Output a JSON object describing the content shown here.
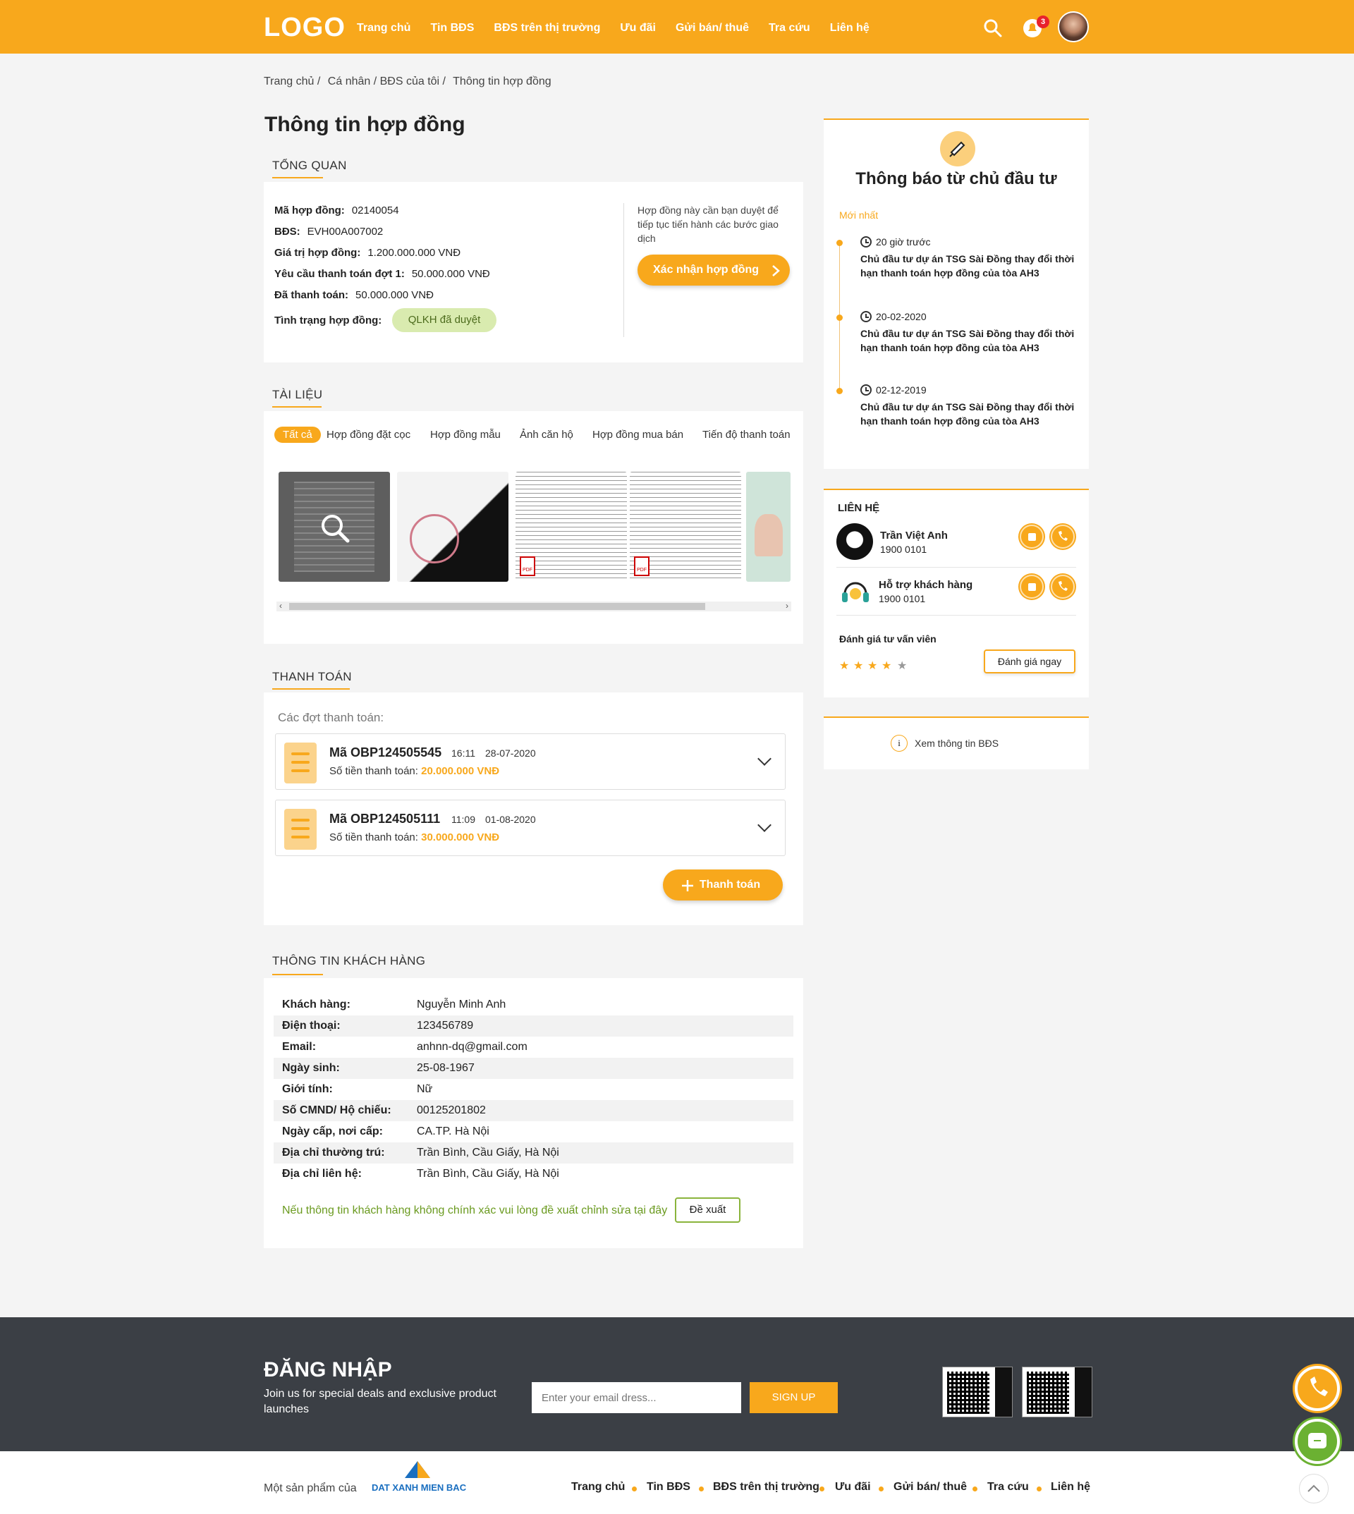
{
  "header": {
    "logo": "LOGO",
    "nav": [
      "Trang chủ",
      "Tin BĐS",
      "BĐS trên thị trường",
      "Ưu đãi",
      "Gửi bán/ thuê",
      "Tra cứu",
      "Liên hệ"
    ],
    "notif_count": "3"
  },
  "breadcrumb": [
    "Trang chủ /",
    "Cá nhân / BĐS của tôi /",
    "Thông tin hợp đồng"
  ],
  "page_title": "Thông tin hợp đồng",
  "overview": {
    "title": "TỔNG QUAN",
    "rows": [
      {
        "k": "Mã hợp đồng:",
        "v": "02140054"
      },
      {
        "k": "BĐS:",
        "v": "EVH00A007002"
      },
      {
        "k": "Giá trị hợp đồng:",
        "v": "1.200.000.000 VNĐ"
      },
      {
        "k": "Yêu cầu thanh toán đợt 1:",
        "v": "50.000.000 VNĐ"
      },
      {
        "k": "Đã thanh toán:",
        "v": "50.000.000 VNĐ"
      }
    ],
    "status_label": "Tình trạng hợp đồng:",
    "status": "QLKH đã duyệt",
    "note": "Hợp đồng này cần bạn duyệt để tiếp tục tiến hành các bước giao dịch",
    "confirm": "Xác nhận hợp đồng"
  },
  "docs": {
    "title": "TÀI LIỆU",
    "tabs": [
      "Tất cả",
      "Hợp đồng đặt cọc",
      "Hợp đồng mẫu",
      "Ảnh căn hộ",
      "Hợp đồng mua bán",
      "Tiến độ thanh toán"
    ]
  },
  "payment": {
    "title": "THANH TOÁN",
    "subtitle": "Các đợt thanh toán:",
    "items": [
      {
        "code": "Mã OBP124505545",
        "time": "16:11",
        "date": "28-07-2020",
        "amt_label": "Số tiền thanh toán:",
        "amt": "20.000.000 VNĐ"
      },
      {
        "code": "Mã OBP124505111",
        "time": "11:09",
        "date": "01-08-2020",
        "amt_label": "Số tiền thanh toán:",
        "amt": "30.000.000 VNĐ"
      }
    ],
    "button": "Thanh toán"
  },
  "customer": {
    "title": "THÔNG TIN KHÁCH HÀNG",
    "rows": [
      {
        "k": "Khách hàng:",
        "v": "Nguyễn Minh Anh"
      },
      {
        "k": "Điện thoại:",
        "v": "123456789"
      },
      {
        "k": "Email:",
        "v": "anhnn-dq@gmail.com"
      },
      {
        "k": "Ngày sinh:",
        "v": "25-08-1967"
      },
      {
        "k": "Giới tính:",
        "v": "Nữ"
      },
      {
        "k": "Số CMND/ Hộ chiếu:",
        "v": "00125201802"
      },
      {
        "k": "Ngày cấp, nơi cấp:",
        "v": "CA.TP. Hà Nội"
      },
      {
        "k": "Địa chỉ thường trú:",
        "v": "Trần Bình, Cầu Giấy, Hà Nội"
      },
      {
        "k": "Địa chỉ liên hệ:",
        "v": "Trần Bình, Cầu Giấy, Hà Nội"
      }
    ],
    "note": "Nếu thông tin khách hàng không chính xác vui lòng đề xuất chỉnh sửa tại đây",
    "button": "Đề xuất"
  },
  "notices": {
    "title": "Thông báo từ chủ đầu tư",
    "latest": "Mới nhất",
    "items": [
      {
        "time": "20 giờ trước",
        "text": "Chủ đầu tư dự án TSG Sài Đồng thay đổi thời hạn thanh toán hợp đồng của tòa AH3"
      },
      {
        "time": "20-02-2020",
        "text": "Chủ đầu tư dự án TSG Sài Đồng thay đổi thời hạn thanh toán hợp đồng của tòa AH3"
      },
      {
        "time": "02-12-2019",
        "text": "Chủ đầu tư dự án TSG Sài Đồng thay đổi thời hạn thanh toán hợp đồng của tòa AH3"
      }
    ]
  },
  "contact": {
    "title": "LIÊN HỆ",
    "people": [
      {
        "name": "Trần Việt Anh",
        "phone": "1900 0101"
      },
      {
        "name": "Hỗ trợ khách hàng",
        "phone": "1900 0101"
      }
    ],
    "rate_label": "Đánh giá tư vấn viên",
    "rating": 4,
    "rate_button": "Đánh giá ngay"
  },
  "view_property": "Xem thông tin BĐS",
  "footer": {
    "login_title": "ĐĂNG NHẬP",
    "login_sub": "Join us for special deals and exclusive product launches",
    "email_placeholder": "Enter your email dress...",
    "signup": "SIGN UP",
    "product_of": "Một sản phẩm của",
    "brand": "DAT XANH MIEN BAC",
    "nav": [
      "Trang chủ",
      "Tin BĐS",
      "BĐS trên thị trường",
      "Ưu đãi",
      "Gửi bán/ thuê",
      "Tra cứu",
      "Liên hệ"
    ]
  },
  "colors": {
    "accent": "#f8a81c",
    "footer_bg": "#3b3f45",
    "status_bg": "#d9ebaf"
  }
}
